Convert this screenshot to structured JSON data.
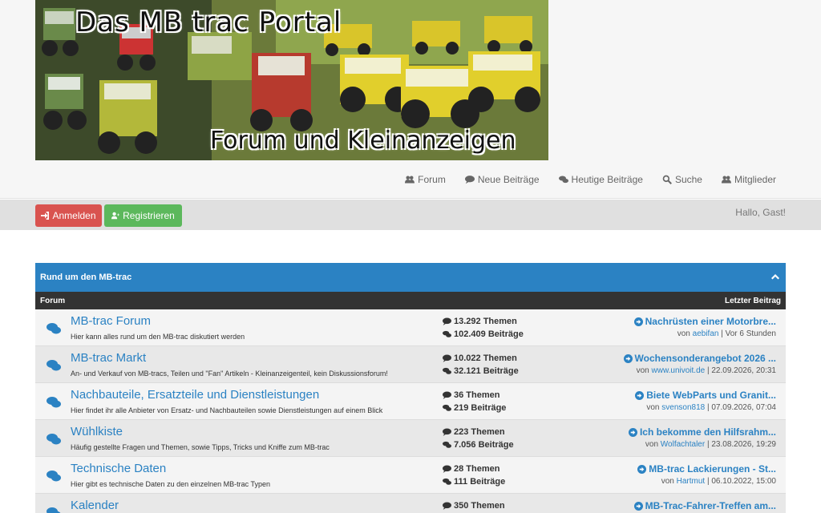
{
  "banner": {
    "title": "Das MB trac Portal",
    "subtitle": "Forum und Kleinanzeigen"
  },
  "nav": [
    {
      "label": "Forum",
      "icon": "users-icon"
    },
    {
      "label": "Neue Beiträge",
      "icon": "comment-icon"
    },
    {
      "label": "Heutige Beiträge",
      "icon": "comments-icon"
    },
    {
      "label": "Suche",
      "icon": "search-icon"
    },
    {
      "label": "Mitglieder",
      "icon": "users-icon"
    }
  ],
  "userbar": {
    "login_label": "Anmelden",
    "register_label": "Registrieren",
    "greeting": "Hallo, Gast!"
  },
  "category": {
    "title": "Rund um den MB-trac",
    "col_forum": "Forum",
    "col_last": "Letzter Beitrag"
  },
  "forums": [
    {
      "title": "MB-trac Forum",
      "desc": "Hier kann alles rund um den MB-trac diskutiert werden",
      "topics": "13.292 Themen",
      "posts": "102.409 Beiträge",
      "last_title": "Nachrüsten einer Motorbre...",
      "by_prefix": "von",
      "last_user": "aebifan",
      "last_time": "| Vor 6 Stunden"
    },
    {
      "title": "MB-trac Markt",
      "desc": "An- und Verkauf von MB-tracs, Teilen und \"Fan\" Artikeln - Kleinanzeigenteil, kein Diskussionsforum!",
      "topics": "10.022 Themen",
      "posts": "32.121 Beiträge",
      "last_title": "Wochensonderangebot 2026 ...",
      "by_prefix": "von",
      "last_user": "www.univoit.de",
      "last_time": "| 22.09.2026, 20:31"
    },
    {
      "title": "Nachbauteile, Ersatzteile und Dienstleistungen",
      "desc": "Hier findet ihr alle Anbieter von Ersatz- und Nachbauteilen sowie Dienstleistungen auf einem Blick",
      "topics": "36 Themen",
      "posts": "219 Beiträge",
      "last_title": "Biete WebParts und Granit...",
      "by_prefix": "von",
      "last_user": "svenson818",
      "last_time": "| 07.09.2026, 07:04"
    },
    {
      "title": "Wühlkiste",
      "desc": "Häufig gestellte Fragen und Themen, sowie Tipps, Tricks und Kniffe zum MB-trac",
      "topics": "223 Themen",
      "posts": "7.056 Beiträge",
      "last_title": "Ich bekomme den Hilfsrahm...",
      "by_prefix": "von",
      "last_user": "Wolfachtaler",
      "last_time": "| 23.08.2026, 19:29"
    },
    {
      "title": "Technische Daten",
      "desc": "Hier gibt es technische Daten zu den einzelnen MB-trac Typen",
      "topics": "28 Themen",
      "posts": "111 Beiträge",
      "last_title": "MB-trac Lackierungen - St...",
      "by_prefix": "von",
      "last_user": "Hartmut",
      "last_time": "| 06.10.2022, 15:00"
    },
    {
      "title": "Kalender",
      "desc": "",
      "topics": "350 Themen",
      "posts": "",
      "last_title": "MB-Trac-Fahrer-Treffen am...",
      "by_prefix": "",
      "last_user": "",
      "last_time": ""
    }
  ]
}
